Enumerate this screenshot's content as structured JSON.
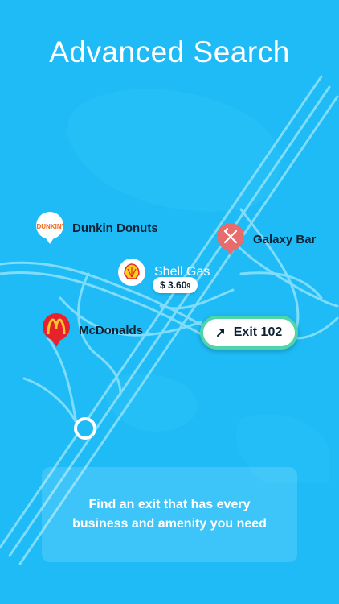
{
  "headline": "Advanced Search",
  "colors": {
    "background": "#1ebbf7",
    "road": "#7fdcfb",
    "exit_border": "#4fd6a8",
    "dunkin": "#f26a21",
    "shell": "#e8222b",
    "mcdonalds": "#e8222b",
    "galaxy": "#e86c6c"
  },
  "places": {
    "dunkin": {
      "label": "Dunkin Donuts",
      "logo_text": "DUNKIN'",
      "icon": "dunkin-logo-icon"
    },
    "galaxy": {
      "label": "Galaxy Bar",
      "icon": "fork-knife-icon"
    },
    "shell": {
      "label": "Shell Gas",
      "icon": "shell-logo-icon",
      "price": "$ 3.60",
      "price_fraction": "9"
    },
    "mcdonalds": {
      "label": "McDonalds",
      "icon": "golden-arches-icon"
    }
  },
  "exit": {
    "label": "Exit 102",
    "icon": "arrow-up-right-icon"
  },
  "callout": {
    "text": "Find an exit that has every business and amenity you need"
  }
}
